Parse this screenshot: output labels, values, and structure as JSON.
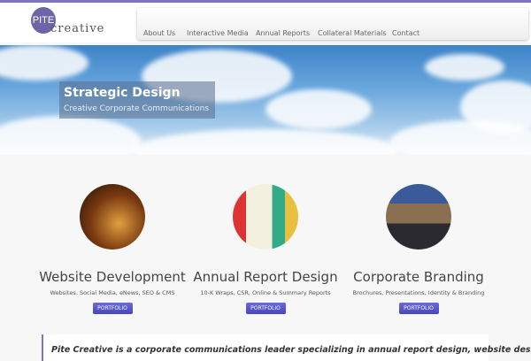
{
  "logo": {
    "mark": "PITE",
    "word": "creative"
  },
  "nav": [
    "About Us",
    "Interactive Media",
    "Annual Reports",
    "Collateral Materials",
    "Contact"
  ],
  "hero": {
    "title": "Strategic Design",
    "subtitle": "Creative Corporate Communications"
  },
  "services": [
    {
      "title": "Website Development",
      "desc": "Websites, Social Media, eNews, SEO & CMS",
      "button": "PORTFOLIO"
    },
    {
      "title": "Annual Report Design",
      "desc": "10-K Wraps, CSR, Online & Summary Reports",
      "button": "PORTFOLIO"
    },
    {
      "title": "Corporate Branding",
      "desc": "Brochures, Presentations, Identity & Branding",
      "button": "PORTFOLIO"
    }
  ],
  "intro": "Pite Creative is a corporate communications leader specializing in annual report design, website design",
  "colors": {
    "accent": "#7b74c9",
    "button": "#5555c8"
  }
}
